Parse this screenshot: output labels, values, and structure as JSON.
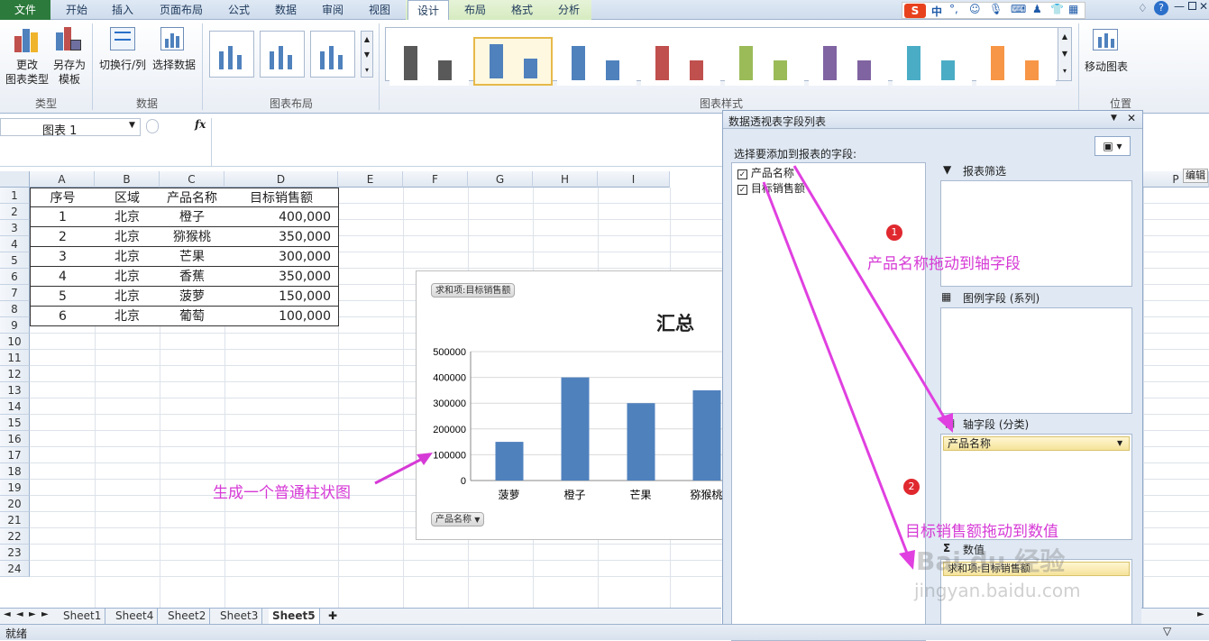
{
  "tabs": {
    "file": "文件",
    "home": "开始",
    "insert": "插入",
    "page_layout": "页面布局",
    "formulas": "公式",
    "data": "数据",
    "review": "审阅",
    "view": "视图",
    "design": "设计",
    "layout": "布局",
    "format": "格式",
    "analyze": "分析"
  },
  "ribbon": {
    "change_type_1": "更改",
    "change_type_2": "图表类型",
    "save_template_1": "另存为",
    "save_template_2": "模板",
    "switch_row_col": "切换行/列",
    "select_data": "选择数据",
    "move_chart": "移动图表",
    "groups": {
      "type": "类型",
      "data": "数据",
      "layout": "图表布局",
      "styles": "图表样式",
      "location": "位置"
    },
    "style_colors": [
      "#595959",
      "#4f81bd",
      "#4f81bd",
      "#c0504d",
      "#9bbb59",
      "#8064a2",
      "#4bacc6",
      "#f79646"
    ]
  },
  "ime": {
    "lang": "中"
  },
  "formula_bar": {
    "name_box": "图表 1",
    "fx": "fx"
  },
  "columns": [
    "A",
    "B",
    "C",
    "D",
    "E",
    "F",
    "G",
    "H",
    "I",
    "P"
  ],
  "rows": [
    "1",
    "2",
    "3",
    "4",
    "5",
    "6",
    "7",
    "8",
    "9",
    "10",
    "11",
    "12",
    "13",
    "14",
    "15",
    "16",
    "17",
    "18",
    "19",
    "20",
    "21",
    "22",
    "23",
    "24"
  ],
  "table": {
    "headers": [
      "序号",
      "区域",
      "产品名称",
      "目标销售额"
    ],
    "rows": [
      [
        "1",
        "北京",
        "橙子",
        "400,000"
      ],
      [
        "2",
        "北京",
        "猕猴桃",
        "350,000"
      ],
      [
        "3",
        "北京",
        "芒果",
        "300,000"
      ],
      [
        "4",
        "北京",
        "香蕉",
        "350,000"
      ],
      [
        "5",
        "北京",
        "菠萝",
        "150,000"
      ],
      [
        "6",
        "北京",
        "葡萄",
        "100,000"
      ]
    ]
  },
  "chart_data": {
    "type": "bar",
    "title": "汇总",
    "value_field_button": "求和项:目标销售额",
    "axis_field_button": "产品名称",
    "categories": [
      "菠萝",
      "橙子",
      "芒果",
      "猕猴桃"
    ],
    "values": [
      150000,
      400000,
      300000,
      350000
    ],
    "y_ticks": [
      "500000",
      "400000",
      "300000",
      "200000",
      "100000",
      "0"
    ],
    "ylim": [
      0,
      500000
    ],
    "bar_color": "#4f81bd",
    "grid": true
  },
  "pivot_panel": {
    "title": "数据透视表字段列表",
    "choose_label": "选择要添加到报表的字段:",
    "fields": [
      "产品名称",
      "目标销售额"
    ],
    "report_filter": "报表筛选",
    "legend_fields": "图例字段 (系列)",
    "axis_fields": "轴字段 (分类)",
    "axis_item": "产品名称",
    "values_label": "数值",
    "values_item": "求和项:目标销售额"
  },
  "annotations": {
    "step1": "产品名称拖动到轴字段",
    "step2": "目标销售额拖动到数值",
    "chart_note": "生成一个普通柱状图",
    "badge1": "1",
    "badge2": "2"
  },
  "sheet_tabs": [
    "Sheet1",
    "Sheet4",
    "Sheet2",
    "Sheet3",
    "Sheet5"
  ],
  "status": {
    "ready": "就绪",
    "edit_hint": "编辑"
  },
  "watermark": {
    "brand": "Bai du 经验",
    "url": "jingyan.baidu.com"
  }
}
